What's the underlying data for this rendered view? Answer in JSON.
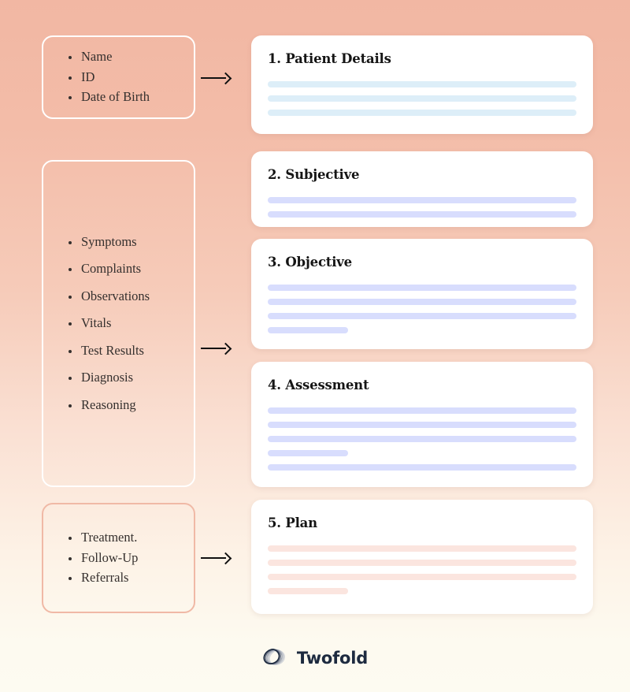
{
  "background": {
    "gradient_from": "#f2b7a3",
    "gradient_to": "#fdfaf0"
  },
  "input_boxes": [
    {
      "id": "identifiers",
      "border_color": "#ffffff",
      "items": [
        "Name",
        "ID",
        "Date of Birth"
      ]
    },
    {
      "id": "clinical",
      "border_color": "#ffffff",
      "items": [
        "Symptoms",
        "Complaints",
        "Observations",
        "Vitals",
        "Test Results",
        "Diagnosis",
        "Reasoning"
      ]
    },
    {
      "id": "plan",
      "border_color": "#f0b9a6",
      "items": [
        "Treatment.",
        "Follow-Up",
        "Referrals"
      ]
    }
  ],
  "arrows": [
    {
      "id": "arrow-1",
      "label": "arrow-right"
    },
    {
      "id": "arrow-2",
      "label": "arrow-right"
    },
    {
      "id": "arrow-3",
      "label": "arrow-right"
    }
  ],
  "cards": [
    {
      "id": "patient-details",
      "title": "1. Patient Details",
      "bar_color": "#ddeef8",
      "bars": [
        100,
        100,
        100
      ]
    },
    {
      "id": "subjective",
      "title": "2. Subjective",
      "bar_color": "#d8ddfd",
      "bars": [
        100,
        100
      ]
    },
    {
      "id": "objective",
      "title": "3. Objective",
      "bar_color": "#d8ddfd",
      "bars": [
        100,
        100,
        100,
        26
      ]
    },
    {
      "id": "assessment",
      "title": "4. Assessment",
      "bar_color": "#d8ddfd",
      "bars": [
        100,
        100,
        100,
        26,
        100
      ]
    },
    {
      "id": "plan",
      "title": "5. Plan",
      "bar_color": "#fbe5df",
      "bars": [
        100,
        100,
        100,
        26
      ]
    }
  ],
  "brand": {
    "name": "Twofold",
    "mark": "twofold-logo-icon",
    "color": "#1d2a3f"
  }
}
